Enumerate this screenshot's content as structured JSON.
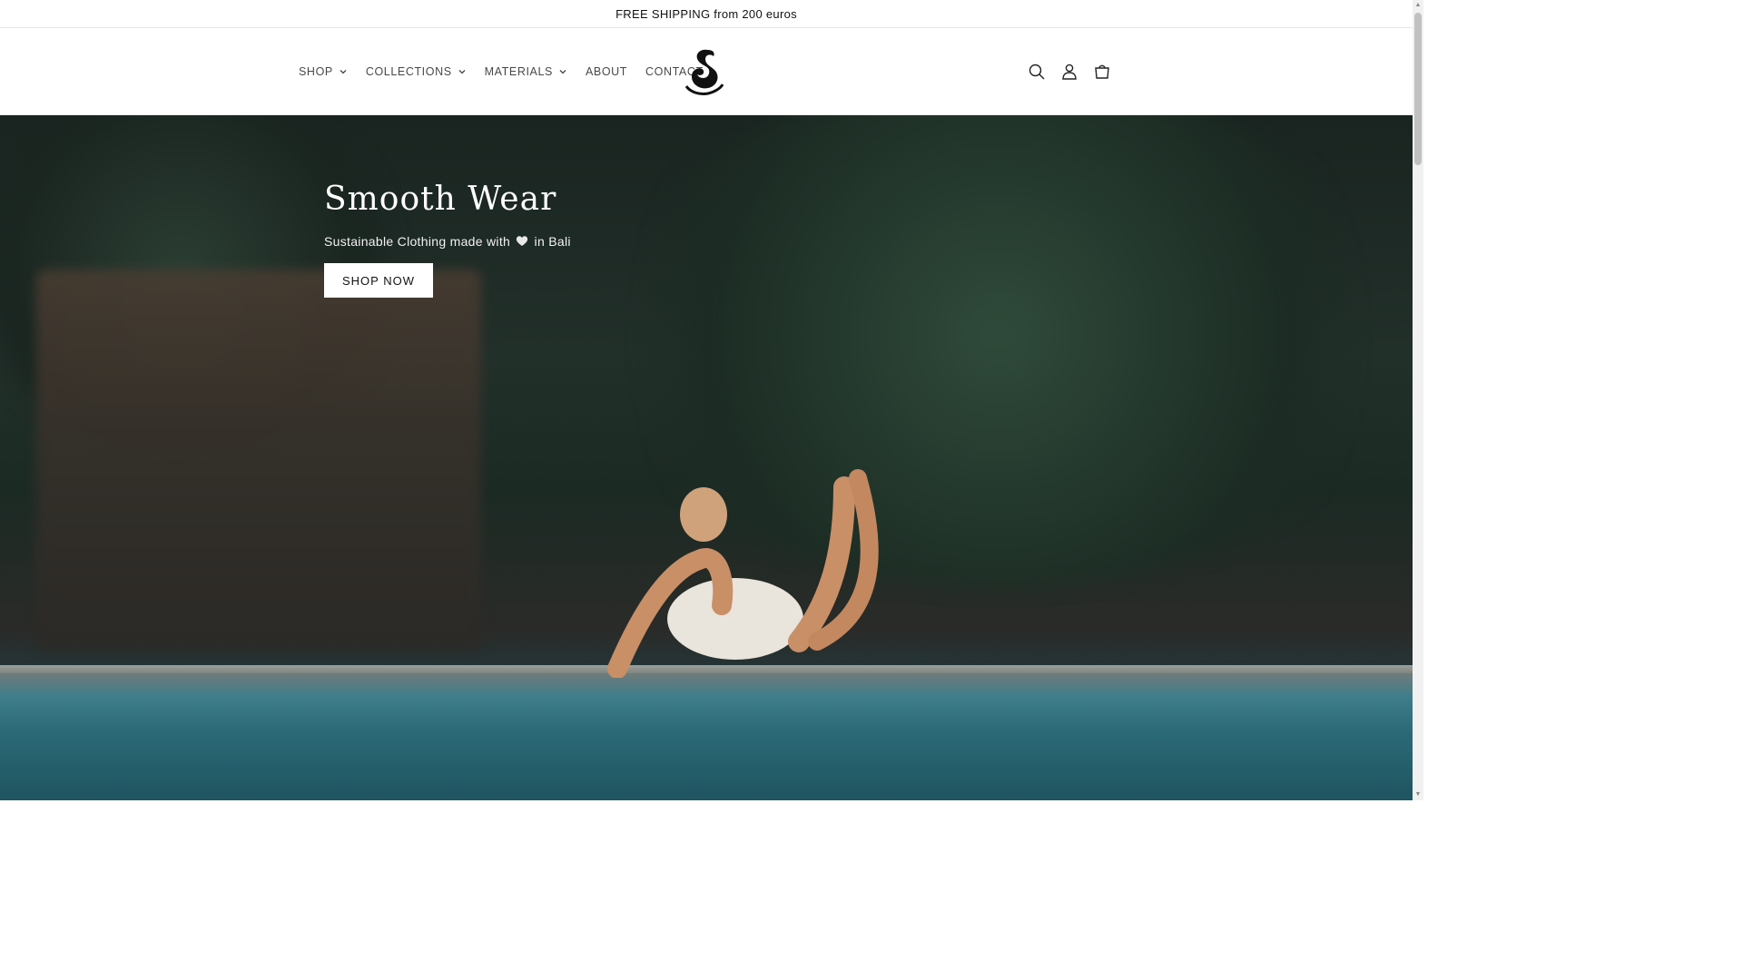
{
  "announcement": {
    "text": "FREE SHIPPING from 200 euros"
  },
  "nav": {
    "items": [
      {
        "label": "SHOP",
        "has_dropdown": true
      },
      {
        "label": "COLLECTIONS",
        "has_dropdown": true
      },
      {
        "label": "MATERIALS",
        "has_dropdown": true
      },
      {
        "label": "ABOUT",
        "has_dropdown": false
      },
      {
        "label": "CONTACT",
        "has_dropdown": false
      }
    ]
  },
  "header_icons": [
    "search-icon",
    "account-icon",
    "cart-icon"
  ],
  "hero": {
    "title": "Smooth Wear",
    "subtitle_prefix": "Sustainable Clothing made with",
    "subtitle_suffix": "in Bali",
    "heart_icon": "heart-icon",
    "button_label": "SHOP NOW"
  },
  "colors": {
    "text": "#121212",
    "hero_text": "#ffffff",
    "button_bg": "#ffffff"
  }
}
